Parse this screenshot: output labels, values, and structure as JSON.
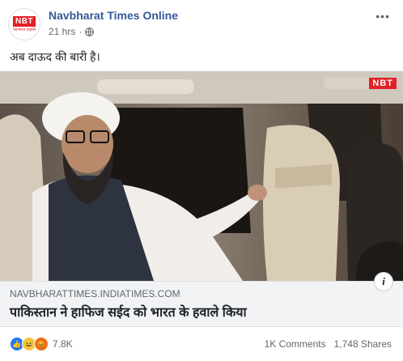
{
  "page": {
    "name": "Navbharat Times Online",
    "time": "21 hrs",
    "separator": "·",
    "avatar_logo": "NBT",
    "avatar_sub": "नवभारत टाइम्स"
  },
  "post": {
    "caption": "अब दाऊद की बारी है।",
    "image_badge": "NBT",
    "link_domain": "NAVBHARATTIMES.INDIATIMES.COM",
    "link_title": "पाकिस्तान ने हाफिज सईद को भारत के हवाले किया"
  },
  "footer": {
    "reaction_count": "7.8K",
    "comments": "1K Comments",
    "shares": "1,748 Shares"
  },
  "icons": {
    "globe": "globe-icon",
    "more": "more-options-icon",
    "info": "info-icon",
    "like": "like-reaction-icon",
    "haha": "haha-reaction-icon",
    "angry": "angry-reaction-icon"
  },
  "colors": {
    "brand_red": "#e41f26",
    "link_blue": "#365899",
    "meta_gray": "#616770"
  },
  "glyphs": {
    "more": "•••",
    "info": "i",
    "like": "👍",
    "haha": "😆",
    "angry": "😡"
  }
}
